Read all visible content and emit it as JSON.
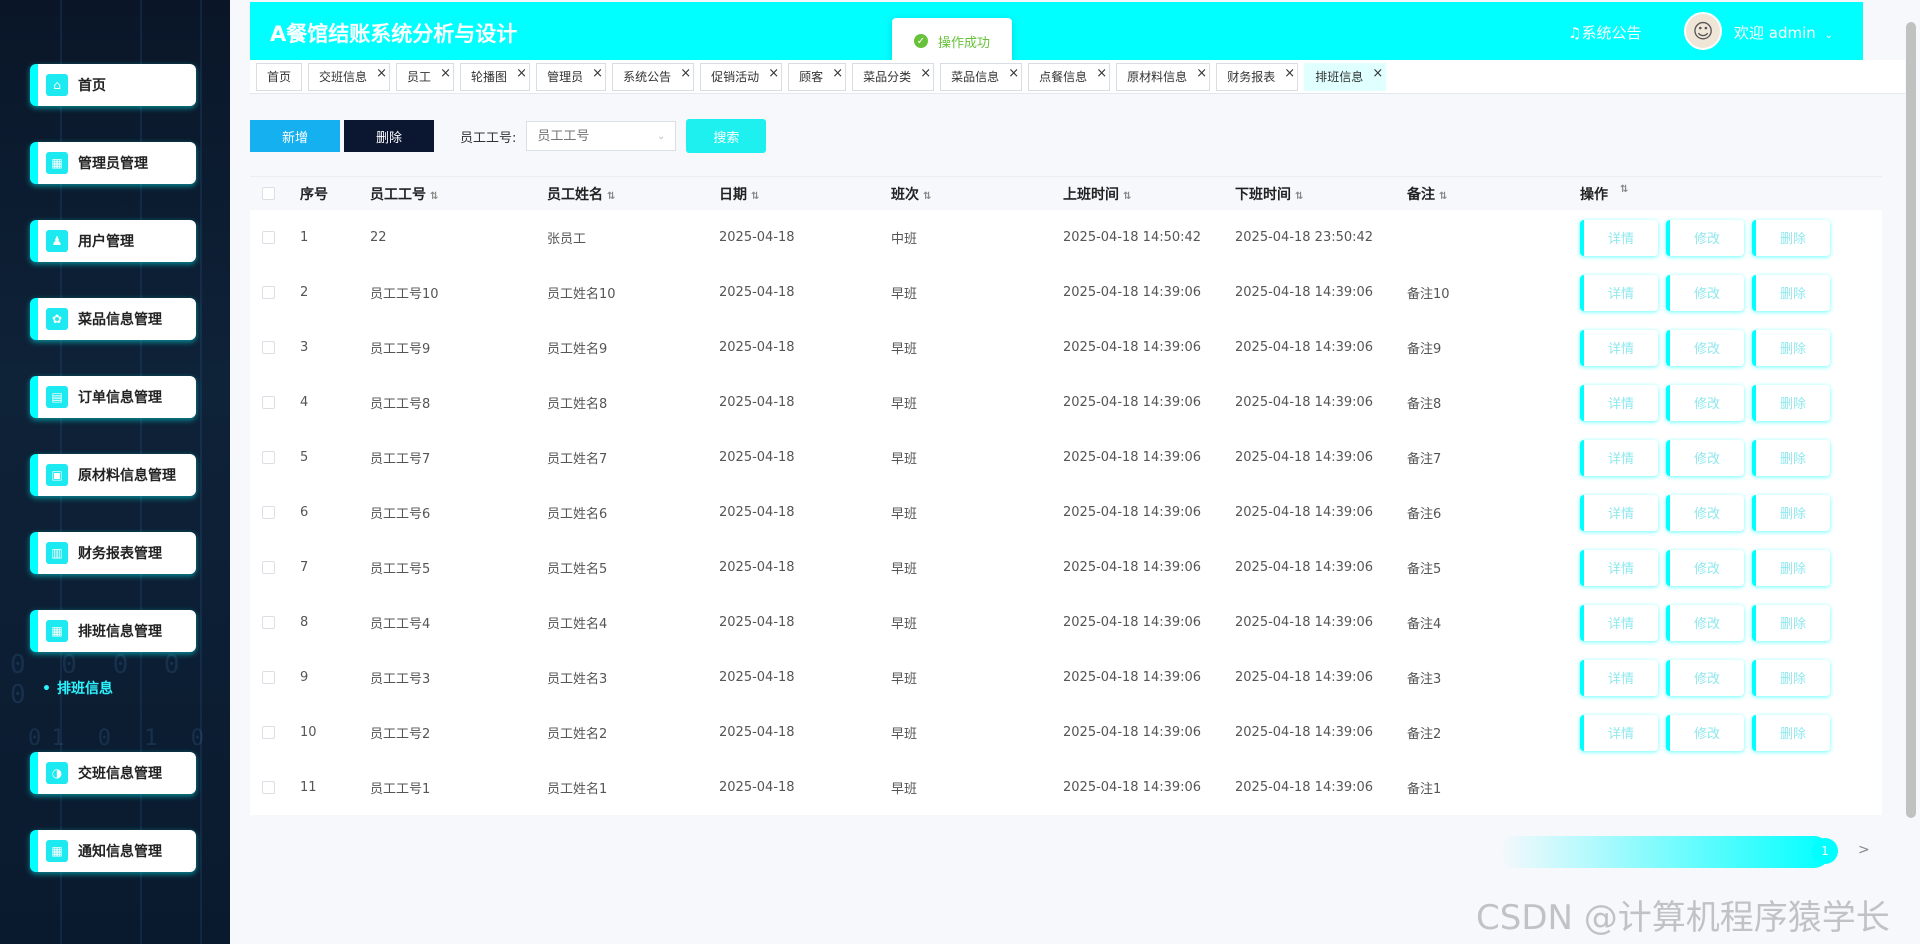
{
  "app_title": "A餐馆结账系统分析与设计",
  "header": {
    "notice": "系统公告",
    "welcome": "欢迎 admin"
  },
  "toast": {
    "message": "操作成功"
  },
  "sidebar": {
    "items": [
      {
        "label": "首页",
        "icon": "home-icon"
      },
      {
        "label": "管理员管理",
        "icon": "admin-icon"
      },
      {
        "label": "用户管理",
        "icon": "user-icon"
      },
      {
        "label": "菜品信息管理",
        "icon": "dish-icon"
      },
      {
        "label": "订单信息管理",
        "icon": "order-icon"
      },
      {
        "label": "原材料信息管理",
        "icon": "material-icon"
      },
      {
        "label": "财务报表管理",
        "icon": "finance-icon"
      },
      {
        "label": "排班信息管理",
        "icon": "schedule-icon"
      },
      {
        "label": "交班信息管理",
        "icon": "handover-icon"
      },
      {
        "label": "通知信息管理",
        "icon": "notice-icon"
      }
    ],
    "sub_item": "排班信息"
  },
  "tabs": [
    "首页",
    "交班信息",
    "员工",
    "轮播图",
    "管理员",
    "系统公告",
    "促销活动",
    "顾客",
    "菜品分类",
    "菜品信息",
    "点餐信息",
    "原材料信息",
    "财务报表",
    "排班信息"
  ],
  "toolbar": {
    "add_label": "新增",
    "delete_label": "删除",
    "filter_label": "员工工号:",
    "filter_placeholder": "员工工号",
    "search_label": "搜索"
  },
  "table": {
    "headers": {
      "no": "序号",
      "id": "员工工号",
      "name": "员工姓名",
      "date": "日期",
      "shift": "班次",
      "on": "上班时间",
      "off": "下班时间",
      "note": "备注",
      "ops": "操作"
    },
    "op_labels": {
      "detail": "详情",
      "edit": "修改",
      "delete": "删除"
    },
    "rows": [
      {
        "no": "1",
        "id": "22",
        "name": "张员工",
        "date": "2025-04-18",
        "shift": "中班",
        "on": "2025-04-18 14:50:42",
        "off": "2025-04-18 23:50:42",
        "note": ""
      },
      {
        "no": "2",
        "id": "员工工号10",
        "name": "员工姓名10",
        "date": "2025-04-18",
        "shift": "早班",
        "on": "2025-04-18 14:39:06",
        "off": "2025-04-18 14:39:06",
        "note": "备注10"
      },
      {
        "no": "3",
        "id": "员工工号9",
        "name": "员工姓名9",
        "date": "2025-04-18",
        "shift": "早班",
        "on": "2025-04-18 14:39:06",
        "off": "2025-04-18 14:39:06",
        "note": "备注9"
      },
      {
        "no": "4",
        "id": "员工工号8",
        "name": "员工姓名8",
        "date": "2025-04-18",
        "shift": "早班",
        "on": "2025-04-18 14:39:06",
        "off": "2025-04-18 14:39:06",
        "note": "备注8"
      },
      {
        "no": "5",
        "id": "员工工号7",
        "name": "员工姓名7",
        "date": "2025-04-18",
        "shift": "早班",
        "on": "2025-04-18 14:39:06",
        "off": "2025-04-18 14:39:06",
        "note": "备注7"
      },
      {
        "no": "6",
        "id": "员工工号6",
        "name": "员工姓名6",
        "date": "2025-04-18",
        "shift": "早班",
        "on": "2025-04-18 14:39:06",
        "off": "2025-04-18 14:39:06",
        "note": "备注6"
      },
      {
        "no": "7",
        "id": "员工工号5",
        "name": "员工姓名5",
        "date": "2025-04-18",
        "shift": "早班",
        "on": "2025-04-18 14:39:06",
        "off": "2025-04-18 14:39:06",
        "note": "备注5"
      },
      {
        "no": "8",
        "id": "员工工号4",
        "name": "员工姓名4",
        "date": "2025-04-18",
        "shift": "早班",
        "on": "2025-04-18 14:39:06",
        "off": "2025-04-18 14:39:06",
        "note": "备注4"
      },
      {
        "no": "9",
        "id": "员工工号3",
        "name": "员工姓名3",
        "date": "2025-04-18",
        "shift": "早班",
        "on": "2025-04-18 14:39:06",
        "off": "2025-04-18 14:39:06",
        "note": "备注3"
      },
      {
        "no": "10",
        "id": "员工工号2",
        "name": "员工姓名2",
        "date": "2025-04-18",
        "shift": "早班",
        "on": "2025-04-18 14:39:06",
        "off": "2025-04-18 14:39:06",
        "note": "备注2"
      },
      {
        "no": "11",
        "id": "员工工号1",
        "name": "员工姓名1",
        "date": "2025-04-18",
        "shift": "早班",
        "on": "2025-04-18 14:39:06",
        "off": "2025-04-18 14:39:06",
        "note": "备注1"
      }
    ]
  },
  "pager": {
    "current": "1",
    "next": ">"
  },
  "watermark": "CSDN @计算机程序猿学长",
  "colors": {
    "accent": "#00ffff",
    "sidebar_bg": "#0a1628",
    "add_btn": "#14b0f0",
    "delete_btn": "#0b1630"
  }
}
